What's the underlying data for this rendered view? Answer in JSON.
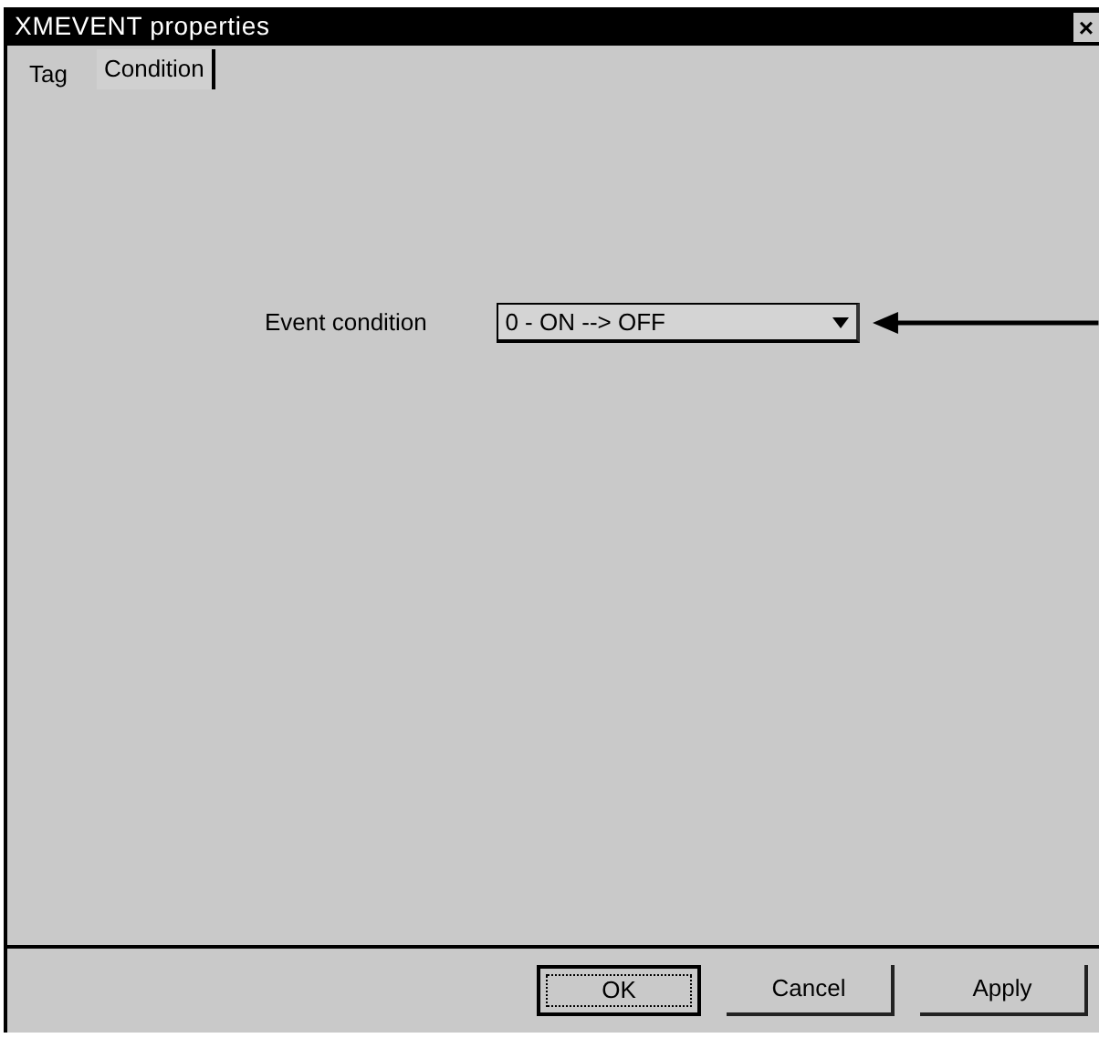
{
  "window": {
    "title": "XMEVENT properties",
    "close": "×"
  },
  "tabs": [
    {
      "label": "Tag",
      "selected": false
    },
    {
      "label": "Condition",
      "selected": true
    }
  ],
  "event_condition": {
    "label": "Event condition",
    "value": "0 - ON --> OFF"
  },
  "buttons": [
    {
      "label": "OK",
      "default": true
    },
    {
      "label": "Cancel",
      "default": false
    },
    {
      "label": "Apply",
      "default": false
    }
  ]
}
